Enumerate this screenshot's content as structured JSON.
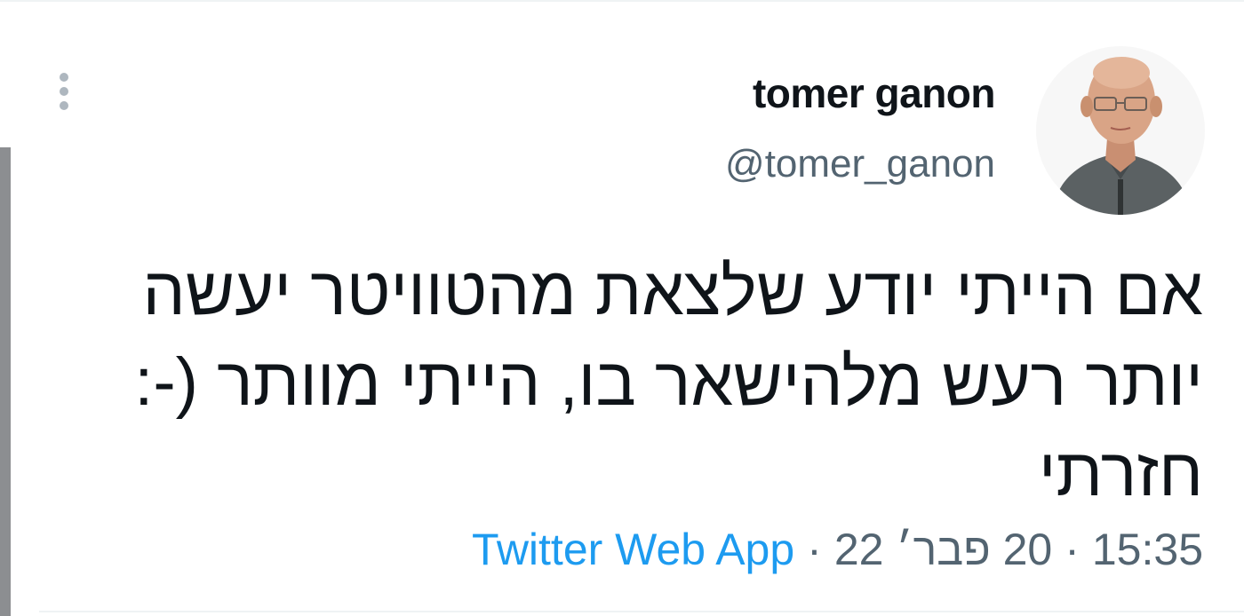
{
  "author": {
    "display_name": "tomer ganon",
    "handle": "@tomer_ganon"
  },
  "tweet": {
    "lines": [
      "אם הייתי יודע שלצאת מהטוויטר יעשה",
      "יותר רעש מלהישאר בו, הייתי מוותר (-:",
      "חזרתי"
    ]
  },
  "meta": {
    "time": "15:35",
    "separator": "·",
    "date": "20 פבר׳ 22",
    "source": "Twitter Web App"
  },
  "icons": {
    "more": "more-vertical-icon",
    "avatar": "profile-photo"
  },
  "colors": {
    "text_primary": "#0f1419",
    "text_secondary": "#536471",
    "link": "#1d9bf0"
  }
}
